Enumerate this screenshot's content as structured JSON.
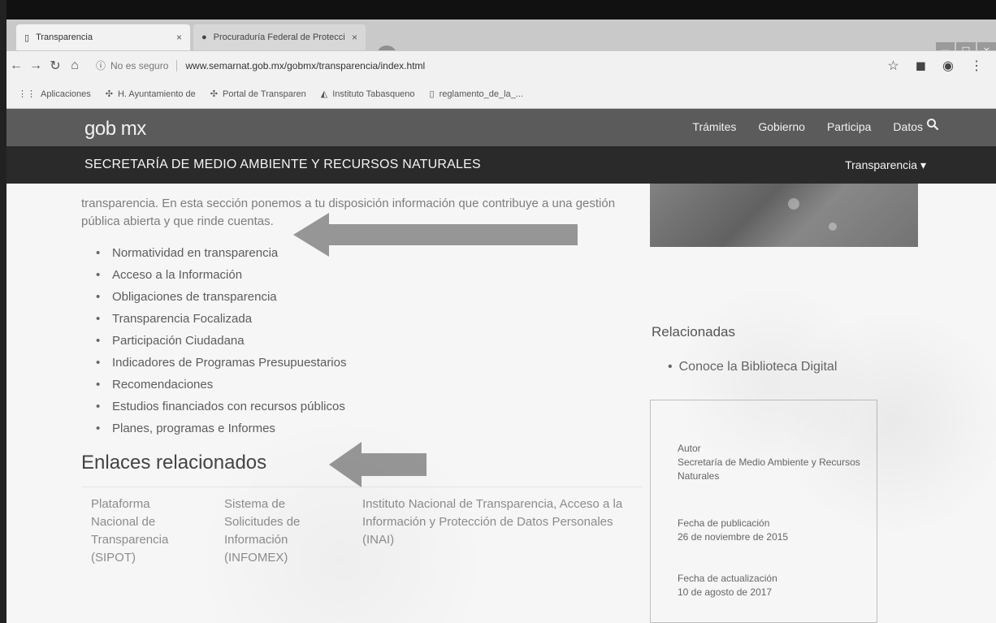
{
  "browser": {
    "tabs": [
      {
        "title": "Transparencia",
        "close": "×"
      },
      {
        "title": "Procuraduría Federal de Protecci",
        "close": "×"
      }
    ],
    "new_tab": "+",
    "window_controls": [
      "—",
      "□",
      "×"
    ],
    "security_text": "No es seguro",
    "url": "www.semarnat.gob.mx/gobmx/transparencia/index.html",
    "bookmarks": [
      "Aplicaciones",
      "H. Ayuntamiento de",
      "Portal de Transparen",
      "Instituto Tabasqueno",
      "reglamento_de_la_..."
    ]
  },
  "header": {
    "brand": "gob mx",
    "nav": [
      "Trámites",
      "Gobierno",
      "Participa",
      "Datos"
    ],
    "search_icon": "search-icon"
  },
  "subheader": {
    "ministry": "SECRETARÍA DE MEDIO AMBIENTE Y RECURSOS NATURALES",
    "menu": "Transparencia ▾"
  },
  "main": {
    "intro": "transparencia. En esta sección ponemos a tu disposición información que contribuye a una gestión pública abierta y que rinde cuentas.",
    "items": [
      "Normatividad en transparencia",
      "Acceso a la Información",
      "Obligaciones de transparencia",
      "Transparencia Focalizada",
      "Participación Ciudadana",
      "Indicadores de Programas Presupuestarios",
      "Recomendaciones",
      "Estudios financiados con recursos públicos",
      "Planes, programas e Informes"
    ],
    "related_links_title": "Enlaces relacionados",
    "related_links": [
      "Plataforma Nacional de Transparencia (SIPOT)",
      "Sistema de Solicitudes de Información (INFOMEX)",
      "Instituto Nacional de Transparencia, Acceso a la Información y Protección de Datos Personales (INAI)"
    ]
  },
  "sidebar": {
    "related_title": "Relacionadas",
    "related_link": "Conoce la Biblioteca Digital",
    "author_label": "Autor",
    "author": "Secretaría de Medio Ambiente y Recursos Naturales",
    "published_label": "Fecha de publicación",
    "published": "26 de noviembre de 2015",
    "updated_label": "Fecha de actualización",
    "updated": "10 de agosto de 2017"
  },
  "colors": {
    "header": "#5b5b5b",
    "subheader": "#2a2a2a",
    "arrow": "#808080"
  }
}
